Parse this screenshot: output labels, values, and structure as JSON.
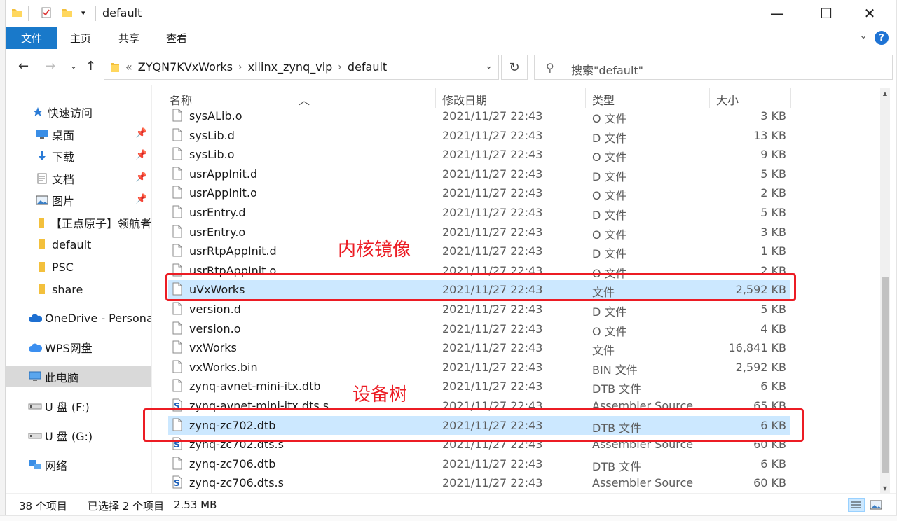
{
  "window": {
    "title": "default",
    "controls": {
      "minimize": "—",
      "maximize": "☐",
      "close": "✕"
    }
  },
  "ribbon": {
    "tabs": [
      "文件",
      "主页",
      "共享",
      "查看"
    ],
    "help": "?"
  },
  "address": {
    "prefix": "«",
    "crumbs": [
      "ZYQN7KVxWorks",
      "xilinx_zynq_vip",
      "default"
    ],
    "search_placeholder": "搜索\"default\""
  },
  "sidebar": {
    "items": [
      {
        "label": "快速访问",
        "icon": "star-icon",
        "pinned": false,
        "indent": 1
      },
      {
        "label": "桌面",
        "icon": "desktop-icon",
        "pinned": true,
        "indent": 2
      },
      {
        "label": "下载",
        "icon": "download-icon",
        "pinned": true,
        "indent": 2
      },
      {
        "label": "文档",
        "icon": "document-icon",
        "pinned": true,
        "indent": 2
      },
      {
        "label": "图片",
        "icon": "picture-icon",
        "pinned": true,
        "indent": 2
      },
      {
        "label": "【正点原子】领航者",
        "icon": "folder-icon",
        "pinned": false,
        "indent": 2
      },
      {
        "label": "default",
        "icon": "folder-icon",
        "pinned": false,
        "indent": 2
      },
      {
        "label": "PSC",
        "icon": "folder-icon",
        "pinned": false,
        "indent": 2
      },
      {
        "label": "share",
        "icon": "folder-icon",
        "pinned": false,
        "indent": 2
      },
      {
        "label": "OneDrive - Persona",
        "icon": "cloud-icon",
        "pinned": false,
        "indent": 1
      },
      {
        "label": "WPS网盘",
        "icon": "wps-cloud-icon",
        "pinned": false,
        "indent": 1
      },
      {
        "label": "此电脑",
        "icon": "computer-icon",
        "pinned": false,
        "indent": 1,
        "selected": true
      },
      {
        "label": "U 盘 (F:)",
        "icon": "usb-drive-icon",
        "pinned": false,
        "indent": 1
      },
      {
        "label": "U 盘 (G:)",
        "icon": "usb-drive-icon",
        "pinned": false,
        "indent": 1
      },
      {
        "label": "网络",
        "icon": "network-icon",
        "pinned": false,
        "indent": 1
      }
    ]
  },
  "columns": {
    "name": "名称",
    "date": "修改日期",
    "type": "类型",
    "size": "大小"
  },
  "files": [
    {
      "name": "sysALib.o",
      "date": "2021/11/27 22:43",
      "type": "O 文件",
      "size": "3 KB",
      "icon": "file-icon"
    },
    {
      "name": "sysLib.d",
      "date": "2021/11/27 22:43",
      "type": "D 文件",
      "size": "13 KB",
      "icon": "file-icon"
    },
    {
      "name": "sysLib.o",
      "date": "2021/11/27 22:43",
      "type": "O 文件",
      "size": "9 KB",
      "icon": "file-icon"
    },
    {
      "name": "usrAppInit.d",
      "date": "2021/11/27 22:43",
      "type": "D 文件",
      "size": "5 KB",
      "icon": "file-icon"
    },
    {
      "name": "usrAppInit.o",
      "date": "2021/11/27 22:43",
      "type": "O 文件",
      "size": "2 KB",
      "icon": "file-icon"
    },
    {
      "name": "usrEntry.d",
      "date": "2021/11/27 22:43",
      "type": "D 文件",
      "size": "5 KB",
      "icon": "file-icon"
    },
    {
      "name": "usrEntry.o",
      "date": "2021/11/27 22:43",
      "type": "O 文件",
      "size": "3 KB",
      "icon": "file-icon"
    },
    {
      "name": "usrRtpAppInit.d",
      "date": "2021/11/27 22:43",
      "type": "D 文件",
      "size": "1 KB",
      "icon": "file-icon"
    },
    {
      "name": "usrRtpAppInit.o",
      "date": "2021/11/27 22:43",
      "type": "O 文件",
      "size": "2 KB",
      "icon": "file-icon"
    },
    {
      "name": "uVxWorks",
      "date": "2021/11/27 22:43",
      "type": "文件",
      "size": "2,592 KB",
      "icon": "file-icon",
      "selected": true
    },
    {
      "name": "version.d",
      "date": "2021/11/27 22:43",
      "type": "D 文件",
      "size": "5 KB",
      "icon": "file-icon"
    },
    {
      "name": "version.o",
      "date": "2021/11/27 22:43",
      "type": "O 文件",
      "size": "4 KB",
      "icon": "file-icon"
    },
    {
      "name": "vxWorks",
      "date": "2021/11/27 22:43",
      "type": "文件",
      "size": "16,841 KB",
      "icon": "file-icon"
    },
    {
      "name": "vxWorks.bin",
      "date": "2021/11/27 22:43",
      "type": "BIN 文件",
      "size": "2,592 KB",
      "icon": "file-icon"
    },
    {
      "name": "zynq-avnet-mini-itx.dtb",
      "date": "2021/11/27 22:43",
      "type": "DTB 文件",
      "size": "6 KB",
      "icon": "file-icon"
    },
    {
      "name": "zynq-avnet-mini-itx.dts.s",
      "date": "2021/11/27 22:43",
      "type": "Assembler Source",
      "size": "65 KB",
      "icon": "assembler-file-icon"
    },
    {
      "name": "zynq-zc702.dtb",
      "date": "2021/11/27 22:43",
      "type": "DTB 文件",
      "size": "6 KB",
      "icon": "file-icon",
      "selected": true
    },
    {
      "name": "zynq-zc702.dts.s",
      "date": "2021/11/27 22:43",
      "type": "Assembler Source",
      "size": "60 KB",
      "icon": "assembler-file-icon"
    },
    {
      "name": "zynq-zc706.dtb",
      "date": "2021/11/27 22:43",
      "type": "DTB 文件",
      "size": "6 KB",
      "icon": "file-icon"
    },
    {
      "name": "zynq-zc706.dts.s",
      "date": "2021/11/27 22:43",
      "type": "Assembler Source",
      "size": "60 KB",
      "icon": "assembler-file-icon"
    }
  ],
  "annotations": {
    "kernel_image": "内核镜像",
    "device_tree": "设备树",
    "color": "#ec1c24"
  },
  "status": {
    "count": "38 个项目",
    "selection": "已选择 2 个项目",
    "selection_size": "2.53 MB"
  },
  "colors": {
    "accent": "#1979ca",
    "selected_row": "#cce8ff",
    "sidebar_selected": "#d9d9d9"
  }
}
